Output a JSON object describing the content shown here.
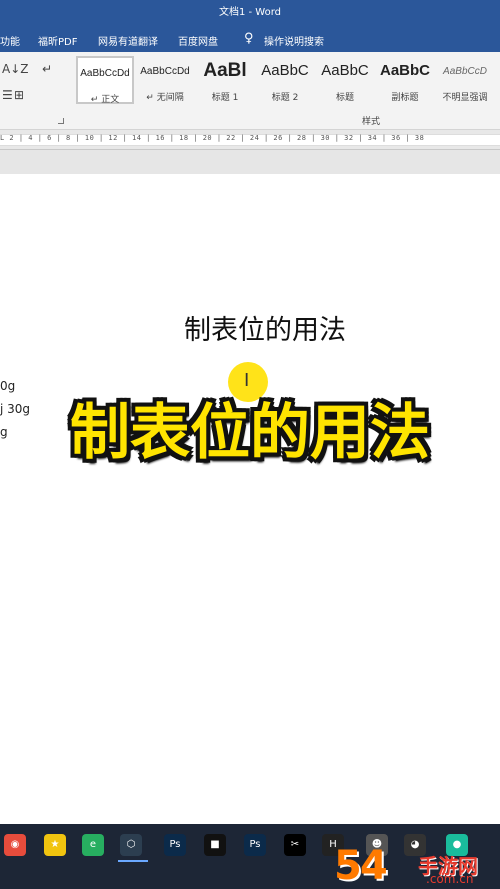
{
  "window": {
    "title": "文档1 - Word"
  },
  "menu": {
    "items": [
      "功能",
      "福昕PDF",
      "网易有道翻译",
      "百度网盘",
      "操作说明搜索"
    ]
  },
  "ribbon": {
    "para_tools": {
      "sort": "A↓Z",
      "marks": "↵",
      "indent": "☰",
      "border": "⊞"
    },
    "styles": [
      {
        "sample": "AaBbCcDd",
        "name": "↵ 正文",
        "selected": true
      },
      {
        "sample": "AaBbCcDd",
        "name": "↵ 无间隔"
      },
      {
        "sample": "AaBl",
        "name": "标题 1"
      },
      {
        "sample": "AaBbC",
        "name": "标题 2"
      },
      {
        "sample": "AaBbC",
        "name": "标题"
      },
      {
        "sample": "AaBbC",
        "name": "副标题"
      },
      {
        "sample": "AaBbCcD",
        "name": "不明显强调"
      }
    ],
    "group_label": "样式"
  },
  "ruler": {
    "ticks": "L  2 | 4 | 6 | 8 | 10 | 12 | 14 | 16 | 18 | 20 | 22 | 24 | 26 | 28 | 30 | 32 | 34 | 36 | 38"
  },
  "document": {
    "heading": "制表位的用法",
    "side_lines": [
      "0g",
      "j 30g",
      "g"
    ]
  },
  "overlay": {
    "caption": "制表位的用法"
  },
  "taskbar": {
    "icons": [
      {
        "name": "chrome",
        "glyph": "◉",
        "color": "#e74c3c"
      },
      {
        "name": "star-app",
        "glyph": "★",
        "color": "#f1c40f"
      },
      {
        "name": "360-browser",
        "glyph": "e",
        "color": "#27ae60"
      },
      {
        "name": "virtualbox",
        "glyph": "⬡",
        "color": "#2c3e50"
      },
      {
        "name": "photoshop",
        "glyph": "Ps",
        "color": "#0b2a4a"
      },
      {
        "name": "dark-app",
        "glyph": "■",
        "color": "#111111"
      },
      {
        "name": "photoshop-2",
        "glyph": "Ps",
        "color": "#0b2a4a"
      },
      {
        "name": "capcut",
        "glyph": "✂",
        "color": "#000000"
      },
      {
        "name": "h-app",
        "glyph": "H",
        "color": "#222222"
      },
      {
        "name": "user-app",
        "glyph": "☻",
        "color": "#555555"
      },
      {
        "name": "qq",
        "glyph": "◕",
        "color": "#333333"
      },
      {
        "name": "green-app",
        "glyph": "●",
        "color": "#1abc9c"
      },
      {
        "name": "avatar-app",
        "glyph": "☺",
        "color": "#8e44ad"
      }
    ]
  },
  "watermark": {
    "number": "54",
    "brand": "手游网",
    "domain": ".com.cn"
  }
}
